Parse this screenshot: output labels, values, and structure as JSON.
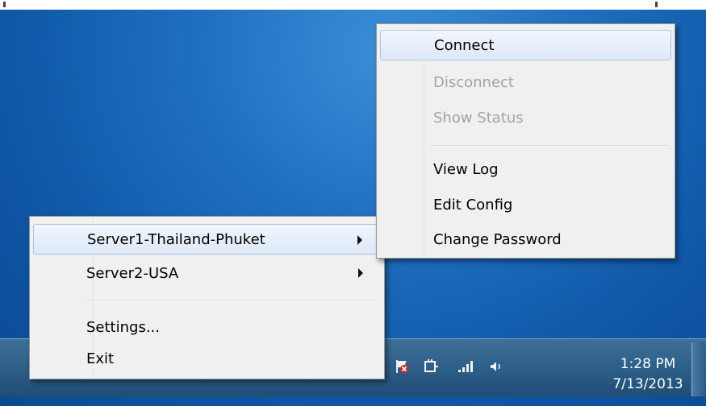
{
  "server_menu": {
    "items": [
      {
        "label": "Server1-Thailand-Phuket",
        "has_submenu": true,
        "highlighted": true
      },
      {
        "label": "Server2-USA",
        "has_submenu": true
      },
      {
        "label": "Settings..."
      },
      {
        "label": "Exit"
      }
    ]
  },
  "action_menu": {
    "items": [
      {
        "label": "Connect",
        "enabled": true,
        "highlighted": true
      },
      {
        "label": "Disconnect",
        "enabled": false
      },
      {
        "label": "Show Status",
        "enabled": false
      },
      {
        "label": "View Log",
        "enabled": true
      },
      {
        "label": "Edit Config",
        "enabled": true
      },
      {
        "label": "Change Password",
        "enabled": true
      }
    ]
  },
  "tray": {
    "icons": [
      "network-status-icon",
      "action-center-flag-icon",
      "power-plug-icon",
      "signal-bars-icon",
      "volume-icon"
    ],
    "time": "1:28 PM",
    "date": "7/13/2013"
  },
  "colors": {
    "highlight_border": "#a8c4e8",
    "disabled_text": "#a3a3a3",
    "menu_bg": "#f0f0f0"
  }
}
